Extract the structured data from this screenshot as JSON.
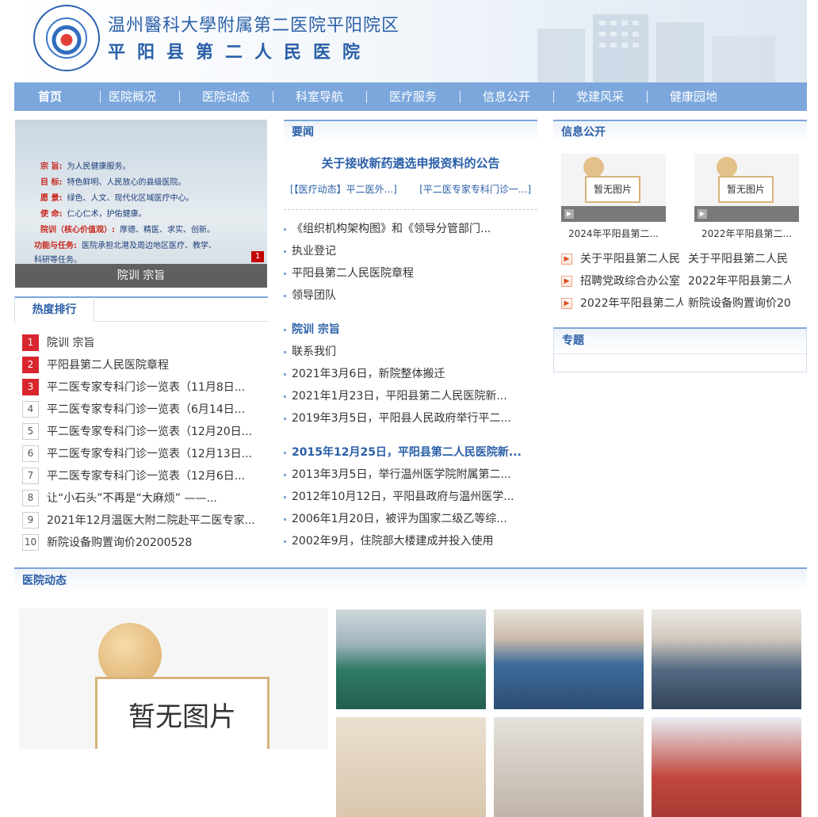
{
  "header": {
    "hospital_name_cn": "温州醫科大學附属第二医院平阳院区",
    "hospital_name_local": "平阳县第二人民医院"
  },
  "nav": {
    "items": [
      "首页",
      "医院概况",
      "医院动态",
      "科室导航",
      "医疗服务",
      "信息公开",
      "党建风采",
      "健康园地"
    ]
  },
  "slide": {
    "caption": "院训 宗旨",
    "index": "1",
    "lines": [
      {
        "k": "宗  旨:",
        "v": "为人民健康服务。"
      },
      {
        "k": "目  标:",
        "v": "特色鲜明、人民放心的县级医院。"
      },
      {
        "k": "愿  景:",
        "v": "绿色、人文、现代化区域医疗中心。"
      },
      {
        "k": "使  命:",
        "v": "仁心仁术，护佑健康。"
      },
      {
        "k": "院训（核心价值观）:",
        "v": "厚德、精医、求实、创新。"
      },
      {
        "k": "功能与任务:",
        "v": "医院承担北港及周边地区医疗、教学、"
      },
      {
        "k": "",
        "v": "科研等任务。"
      }
    ]
  },
  "ranking": {
    "tab_label": "热度排行",
    "items": [
      {
        "n": "1",
        "text": "院训 宗旨"
      },
      {
        "n": "2",
        "text": "平阳县第二人民医院章程"
      },
      {
        "n": "3",
        "text": "平二医专家专科门诊一览表（11月8日..."
      },
      {
        "n": "4",
        "text": "平二医专家专科门诊一览表（6月14日..."
      },
      {
        "n": "5",
        "text": "平二医专家专科门诊一览表（12月20日..."
      },
      {
        "n": "6",
        "text": "平二医专家专科门诊一览表（12月13日..."
      },
      {
        "n": "7",
        "text": "平二医专家专科门诊一览表（12月6日..."
      },
      {
        "n": "8",
        "text": "让“小石头”不再是“大麻烦” ——..."
      },
      {
        "n": "9",
        "text": "2021年12月温医大附二院赴平二医专家..."
      },
      {
        "n": "10",
        "text": "新院设备购置询价20200528"
      }
    ]
  },
  "news": {
    "heading": "要闻",
    "headline": "关于接收新药遴选申报资料的公告",
    "sub_links": [
      "[【医疗动态】平二医外...]",
      "[平二医专家专科门诊一...]"
    ],
    "group1": [
      "《组织机构架构图》和《领导分管部门...",
      "执业登记",
      "平阳县第二人民医院章程",
      "领导团队"
    ],
    "group2_title": "院训 宗旨",
    "group2": [
      "联系我们",
      "2021年3月6日，新院整体搬迁",
      "2021年1月23日，平阳县第二人民医院新...",
      "2019年3月5日，平阳县人民政府举行平二..."
    ],
    "group3_title": "2015年12月25日，平阳县第二人民医院新...",
    "group3": [
      "2013年3月5日，举行温州医学院附属第二...",
      "2012年10月12日，平阳县政府与温州医学...",
      "2006年1月20日，被评为国家二级乙等综...",
      "2002年9月，住院部大楼建成并投入使用"
    ]
  },
  "info": {
    "heading": "信息公开",
    "thumbs": [
      {
        "placeholder": "暂无图片",
        "caption": "2024年平阳县第二..."
      },
      {
        "placeholder": "暂无图片",
        "caption": "2022年平阳县第二..."
      }
    ],
    "rows": [
      [
        "关于平阳县第二人民",
        "关于平阳县第二人民"
      ],
      [
        "招聘党政综合办公室",
        "2022年平阳县第二人"
      ],
      [
        "2022年平阳县第二人",
        "新院设备购置询价20"
      ]
    ]
  },
  "topic": {
    "heading": "专题"
  },
  "dynamics": {
    "heading": "医院动态",
    "placeholder": "暂无图片"
  },
  "colors": {
    "nav_bg": "#7ba7dc",
    "accent": "#2a5fa8",
    "hot_badge": "#d9252d"
  }
}
